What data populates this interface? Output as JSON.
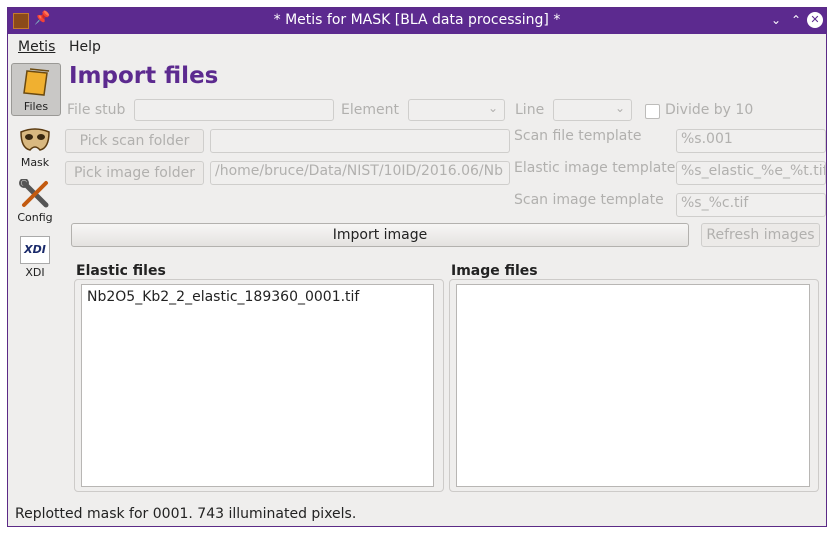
{
  "window": {
    "title": "* Metis for MASK [BLA data processing] *",
    "controls": [
      "chevron-down",
      "chevron-up",
      "close"
    ]
  },
  "menubar": {
    "items": [
      {
        "label": "Metis"
      },
      {
        "label": "Help"
      }
    ]
  },
  "sidebar": {
    "items": [
      {
        "label": "Files",
        "icon": "files-icon",
        "active": true
      },
      {
        "label": "Mask",
        "icon": "mask-icon",
        "active": false
      },
      {
        "label": "Config",
        "icon": "config-icon",
        "active": false
      },
      {
        "label": "XDI",
        "icon": "xdi-icon",
        "active": false
      }
    ],
    "xdi_logo_text": "XDI"
  },
  "main": {
    "heading": "Import files",
    "file_stub_label": "File stub",
    "file_stub_value": "",
    "element_label": "Element",
    "element_value": "",
    "line_label": "Line",
    "line_value": "",
    "divide_label": "Divide by 10",
    "divide_checked": false,
    "pick_scan_folder": "Pick scan folder",
    "scan_folder_value": "",
    "pick_image_folder": "Pick image folder",
    "image_folder_value": "/home/bruce/Data/NIST/10ID/2016.06/Nb",
    "scan_file_template_label": "Scan file template",
    "scan_file_template_value": "%s.001",
    "elastic_image_template_label": "Elastic image template",
    "elastic_image_template_value": "%s_elastic_%e_%t.tif",
    "scan_image_template_label": "Scan image template",
    "scan_image_template_value": "%s_%c.tif",
    "import_image_button": "Import image",
    "refresh_images_button": "Refresh images",
    "elastic_files_label": "Elastic files",
    "elastic_files": [
      "Nb2O5_Kb2_2_elastic_189360_0001.tif"
    ],
    "image_files_label": "Image files",
    "image_files": []
  },
  "status": {
    "text": "Replotted mask for 0001.  743 illuminated pixels."
  },
  "colors": {
    "titlebar": "#5c2a8f",
    "heading": "#5c2a8f",
    "window_bg": "#efeeed"
  }
}
